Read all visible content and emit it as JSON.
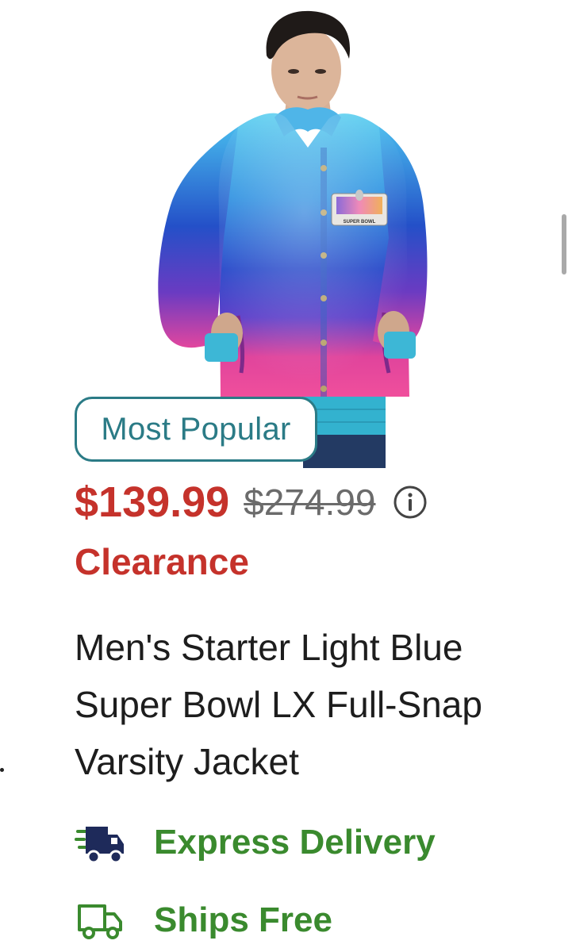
{
  "product": {
    "image_alt": "Men's Starter Light Blue Super Bowl LX Full-Snap Varsity Jacket product photo",
    "patch_text": "SUPER BOWL",
    "badge": "Most Popular",
    "price": {
      "current": "$139.99",
      "original": "$274.99",
      "info_icon": "info-circle-icon"
    },
    "sale_label": "Clearance",
    "title": "Men's Starter Light Blue Super Bowl LX Full-Snap Varsity Jacket",
    "features": [
      {
        "label": "Express Delivery",
        "icon": "express-truck-icon"
      },
      {
        "label": "Ships Free",
        "icon": "truck-icon"
      }
    ]
  },
  "colors": {
    "sale_red": "#c5322b",
    "badge_teal": "#2b7b86",
    "feature_green": "#3a8a2e",
    "strike_gray": "#6b6b6b",
    "express_icon_navy": "#1e2a5a"
  }
}
